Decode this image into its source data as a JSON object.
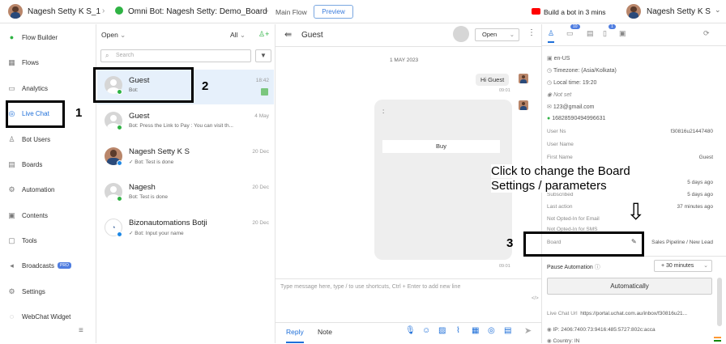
{
  "topbar": {
    "user": "Nagesh Setty K S_1",
    "bot": "Omni Bot: Nagesh Setty: Demo_Board",
    "flow": "Main Flow",
    "preview": "Preview",
    "build": "Build a bot in 3 mins",
    "profile": "Nagesh Setty K S"
  },
  "sidebar": {
    "items": [
      {
        "label": "Flow Builder",
        "icon": "flow-builder-icon"
      },
      {
        "label": "Flows",
        "icon": "flows-icon"
      },
      {
        "label": "Analytics",
        "icon": "analytics-icon"
      },
      {
        "label": "Live Chat",
        "icon": "live-chat-icon"
      },
      {
        "label": "Bot Users",
        "icon": "bot-users-icon"
      },
      {
        "label": "Boards",
        "icon": "boards-icon"
      },
      {
        "label": "Automation",
        "icon": "automation-icon"
      },
      {
        "label": "Contents",
        "icon": "contents-icon"
      },
      {
        "label": "Tools",
        "icon": "tools-icon"
      },
      {
        "label": "Broadcasts",
        "icon": "broadcasts-icon"
      },
      {
        "label": "Settings",
        "icon": "settings-icon"
      },
      {
        "label": "WebChat Widget",
        "icon": "webchat-widget-icon"
      }
    ],
    "pro": "PRO"
  },
  "list": {
    "filter": "Open",
    "scope": "All",
    "search_placeholder": "Search",
    "conversations": [
      {
        "name": "Guest",
        "preview": "Bot:",
        "time": "18:42"
      },
      {
        "name": "Guest",
        "preview": "Bot: Press the Link to Pay : You can visit th...",
        "time": "4 May"
      },
      {
        "name": "Nagesh Setty K S",
        "preview": "Bot: Test is done",
        "time": "20 Dec"
      },
      {
        "name": "Nagesh",
        "preview": "Bot: Test is done",
        "time": "20 Dec"
      },
      {
        "name": "Bizonautomations Botji",
        "preview": "Bot: Input your name",
        "time": "20 Dec"
      }
    ]
  },
  "chat": {
    "title": "Guest",
    "status": "Open",
    "date": "1 MAY 2023",
    "msg1": "Hi Guest",
    "time1": "09:01",
    "card_text": ":",
    "card_button": "Buy",
    "time2": "09:01",
    "input_placeholder": "Type message here, type / to use shortcuts, Ctrl + Enter to add new line",
    "reply": "Reply",
    "note": "Note"
  },
  "right": {
    "tabs_badges": [
      "10",
      "1"
    ],
    "locale": "en-US",
    "timezone": "Timezone: (Asia/Kolkata)",
    "local_time": "Local time: 19:20",
    "not_set": "Not set",
    "email": "123@gmail.com",
    "phone": "16828590494996631",
    "user_ns_label": "User Ns",
    "user_ns": "f30816u21447480",
    "user_name_label": "User Name",
    "first_name_label": "First Name",
    "first_name": "Guest",
    "created_value": "5 days ago",
    "subscribed_label": "Subscribed",
    "subscribed": "5 days ago",
    "last_action_label": "Last action",
    "last_action": "37 minutes ago",
    "optin_email": "Not Opted-In for Email",
    "optin_sms": "Not Opted-In for SMS",
    "board_label": "Board",
    "board_value": "Sales Pipeline / New Lead",
    "pause_label": "Pause Automation",
    "pause_value": "+ 30 minutes",
    "auto_button": "Automatically",
    "live_chat_url_label": "Live Chat Url",
    "live_chat_url": "https://portal.uchat.com.au/inbox/f30816u21...",
    "ip": "IP: 2406:7400:73:9416:485:5727:802c:acca",
    "country": "Country: IN"
  },
  "annotations": {
    "n1": "1",
    "n2": "2",
    "n3": "3",
    "note_line1": "Click to change the Board",
    "note_line2": "Settings / parameters",
    "arrow": "⇩"
  }
}
